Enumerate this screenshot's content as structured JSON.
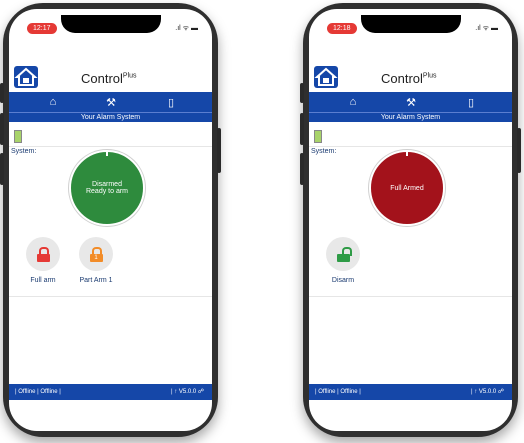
{
  "phones": [
    {
      "status_time": "12:17",
      "app_title": "Control",
      "app_title_sup": "Plus",
      "subtitle": "Your Alarm System",
      "system_label": "System:",
      "state_line1": "Disarmed",
      "state_line2": "Ready to arm",
      "state_color": "#2e8b3d",
      "actions": [
        {
          "label": "Full arm",
          "icon": "lock-icon",
          "color": "#e53935"
        },
        {
          "label": "Part Arm 1",
          "icon": "lock-1-icon",
          "color": "#f28c28",
          "badge": "1"
        }
      ],
      "footer_left": "| Offline | Offline |",
      "footer_right": "| ↑ V5.0.0"
    },
    {
      "status_time": "12:18",
      "app_title": "Control",
      "app_title_sup": "Plus",
      "subtitle": "Your Alarm System",
      "system_label": "System:",
      "state_line1": "Full Armed",
      "state_line2": "",
      "state_color": "#a3121b",
      "actions": [
        {
          "label": "Disarm",
          "icon": "unlock-icon",
          "color": "#2e9b46"
        }
      ],
      "footer_left": "| Offline | Offline |",
      "footer_right": "| ↑ V5.0.0"
    }
  ],
  "colors": {
    "primary": "#1547a8",
    "battery": "#a8d36a"
  }
}
